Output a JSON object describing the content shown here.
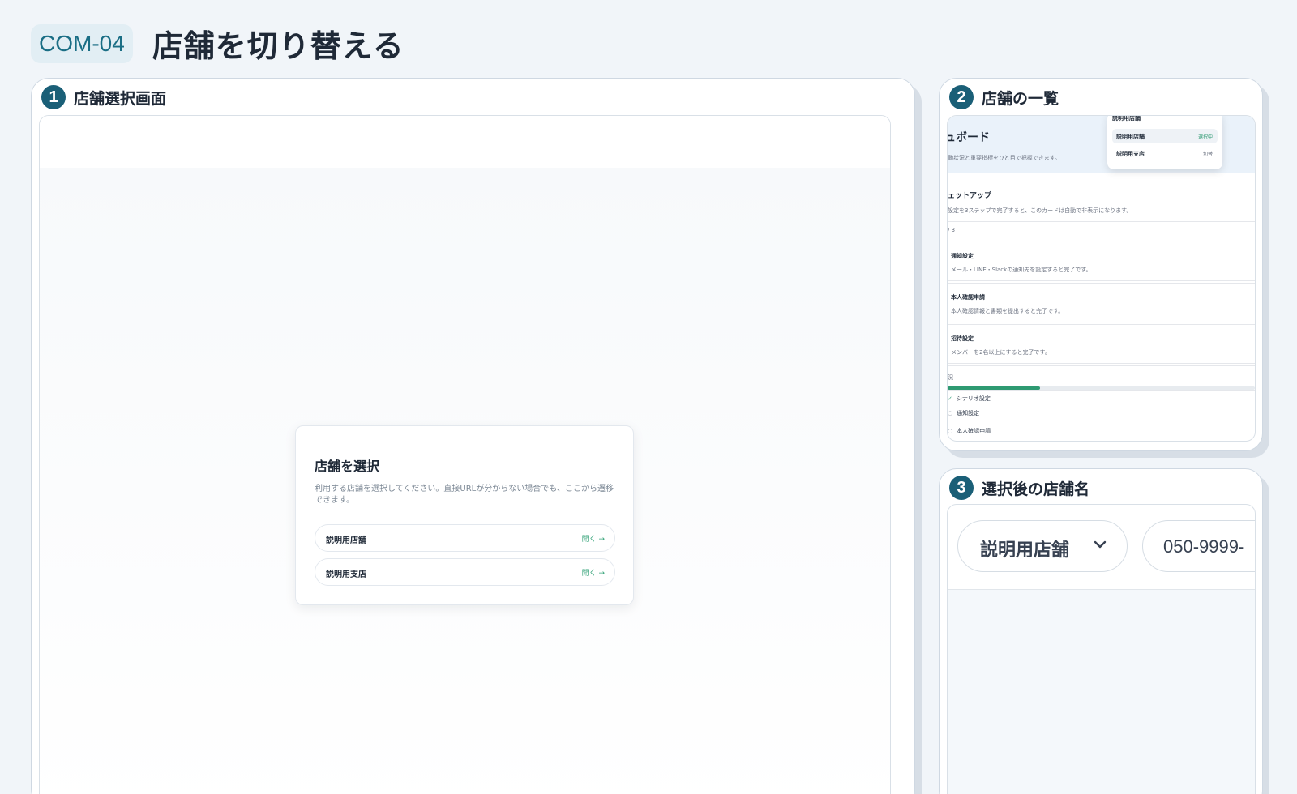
{
  "header": {
    "code": "COM-04",
    "title": "店舗を切り替える"
  },
  "panels": [
    {
      "number": "1",
      "title": "店舗選択画面",
      "card": {
        "title": "店舗を選択",
        "description": "利用する店舗を選択してください。直接URLが分からない場合でも、ここから遷移できます。",
        "stores": [
          {
            "name": "説明用店舗",
            "action": "開く →"
          },
          {
            "name": "説明用支店",
            "action": "開く →"
          }
        ]
      }
    },
    {
      "number": "2",
      "title": "店舗の一覧",
      "dashboard": {
        "title": "ュボード",
        "subtitle": "動状況と重要指標をひと目で把握できます。",
        "dropdown": {
          "header": "説明用店舗",
          "items": [
            {
              "name": "説明用店舗",
              "tag": "選択中",
              "active": true
            },
            {
              "name": "説明用支店",
              "tag": "切替",
              "active": false
            }
          ]
        },
        "setup": {
          "title": "ェットアップ",
          "description": "設定を3ステップで完了すると、このカードは自動で非表示になります。",
          "count": "/ 3"
        },
        "tasks": [
          {
            "title": "通知設定",
            "desc": "メール・LINE・Slackの通知先を設定すると完了です。"
          },
          {
            "title": "本人確認申請",
            "desc": "本人確認情報と書類を提出すると完了です。"
          },
          {
            "title": "招待設定",
            "desc": "メンバーを2名以上にすると完了です。"
          }
        ],
        "progress": {
          "label": "況",
          "value": 0.3
        },
        "checklist": [
          {
            "label": "シナリオ設定",
            "done": true
          },
          {
            "label": "通知設定",
            "done": false
          },
          {
            "label": "本人確認申請",
            "done": false
          }
        ]
      }
    },
    {
      "number": "3",
      "title": "選択後の店舗名",
      "store_selector": {
        "name": "説明用店舗",
        "chevron": "⌄"
      },
      "phone": "050-9999-"
    }
  ],
  "colors": {
    "accent": "#1a5f77",
    "success": "#2e9a72",
    "background": "#f1f5f9"
  },
  "icons": {
    "chevron": "chevron-down-icon",
    "arrow": "arrow-right-icon",
    "check": "check-icon"
  }
}
